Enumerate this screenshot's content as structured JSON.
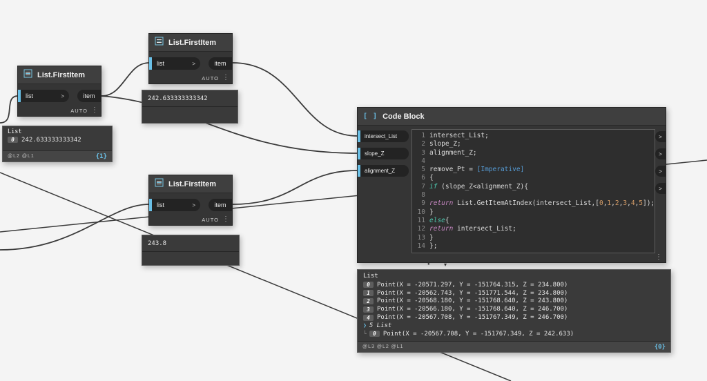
{
  "colors": {
    "canvas": "#f4f4f4",
    "node_header": "#3f3f3f",
    "node_body": "#353535",
    "port_chip": "#232323",
    "accent_cyan": "#6ac0e7",
    "wire": "#3b3b3b"
  },
  "first_item_node": {
    "title": "List.FirstItem",
    "input": "list",
    "default_caret": ">",
    "output": "item",
    "lacing": "AUTO",
    "menu": "⋮"
  },
  "code_block": {
    "icon": "[ ]",
    "title": "Code Block",
    "inputs": [
      "intersect_List",
      "slope_Z",
      "alignment_Z"
    ],
    "output_caret": ">",
    "menu": "⋮",
    "lines": [
      {
        "n": "1",
        "segs": [
          [
            "p",
            "intersect_List;"
          ]
        ]
      },
      {
        "n": "2",
        "segs": [
          [
            "p",
            "slope_Z;"
          ]
        ]
      },
      {
        "n": "3",
        "segs": [
          [
            "p",
            "alignment_Z;"
          ]
        ]
      },
      {
        "n": "4",
        "segs": []
      },
      {
        "n": "5",
        "segs": [
          [
            "p",
            "remove_Pt = "
          ],
          [
            "imp",
            "[Imperative]"
          ]
        ]
      },
      {
        "n": "6",
        "segs": [
          [
            "p",
            "{"
          ]
        ]
      },
      {
        "n": "7",
        "segs": [
          [
            "kw",
            "if"
          ],
          [
            "p",
            " (slope_Z<alignment_Z){"
          ]
        ]
      },
      {
        "n": "8",
        "segs": []
      },
      {
        "n": "9",
        "segs": [
          [
            "ret",
            "return"
          ],
          [
            "p",
            " List.GetItemAtIndex(intersect_List,["
          ],
          [
            "num",
            "0"
          ],
          [
            "p",
            ","
          ],
          [
            "num",
            "1"
          ],
          [
            "p",
            ","
          ],
          [
            "num",
            "2"
          ],
          [
            "p",
            ","
          ],
          [
            "num",
            "3"
          ],
          [
            "p",
            ","
          ],
          [
            "num",
            "4"
          ],
          [
            "p",
            ","
          ],
          [
            "num",
            "5"
          ],
          [
            "p",
            "]);"
          ]
        ]
      },
      {
        "n": "10",
        "segs": [
          [
            "p",
            "}"
          ]
        ]
      },
      {
        "n": "11",
        "segs": [
          [
            "kw",
            "else"
          ],
          [
            "p",
            "{"
          ]
        ]
      },
      {
        "n": "12",
        "segs": [
          [
            "ret",
            "return"
          ],
          [
            "p",
            " intersect_List;"
          ]
        ]
      },
      {
        "n": "13",
        "segs": [
          [
            "p",
            "}"
          ]
        ]
      },
      {
        "n": "14",
        "segs": [
          [
            "p",
            "};"
          ]
        ]
      }
    ]
  },
  "left_preview": {
    "header": "List",
    "row_index": "0",
    "row_value": "242.633333333342",
    "levels": "@L2 @L1",
    "count": "{1}"
  },
  "bubble_top": {
    "value": "242.633333333342"
  },
  "bubble_bottom": {
    "value": "243.8"
  },
  "result_preview": {
    "header": "List",
    "tree_glyph": "└",
    "rows": [
      {
        "index": "0",
        "text": "Point(X = -20571.297, Y = -151764.315, Z = 234.800)"
      },
      {
        "index": "1",
        "text": "Point(X = -20562.743, Y = -151771.544, Z = 234.800)"
      },
      {
        "index": "2",
        "text": "Point(X = -20568.180, Y = -151768.640, Z = 243.800)"
      },
      {
        "index": "3",
        "text": "Point(X = -20566.180, Y = -151768.640, Z = 246.700)"
      },
      {
        "index": "4",
        "text": "Point(X = -20567.708, Y = -151767.349, Z = 246.700)"
      },
      {
        "expander": "❯",
        "label": "5 List"
      },
      {
        "index": "0",
        "text": "Point(X = -20567.708, Y = -151767.349, Z = 242.633)",
        "indent": true
      }
    ],
    "levels": "@L3 @L2 @L1",
    "count": "{0}"
  },
  "preview_toggle": {
    "dot": "●",
    "caret": "▾"
  }
}
